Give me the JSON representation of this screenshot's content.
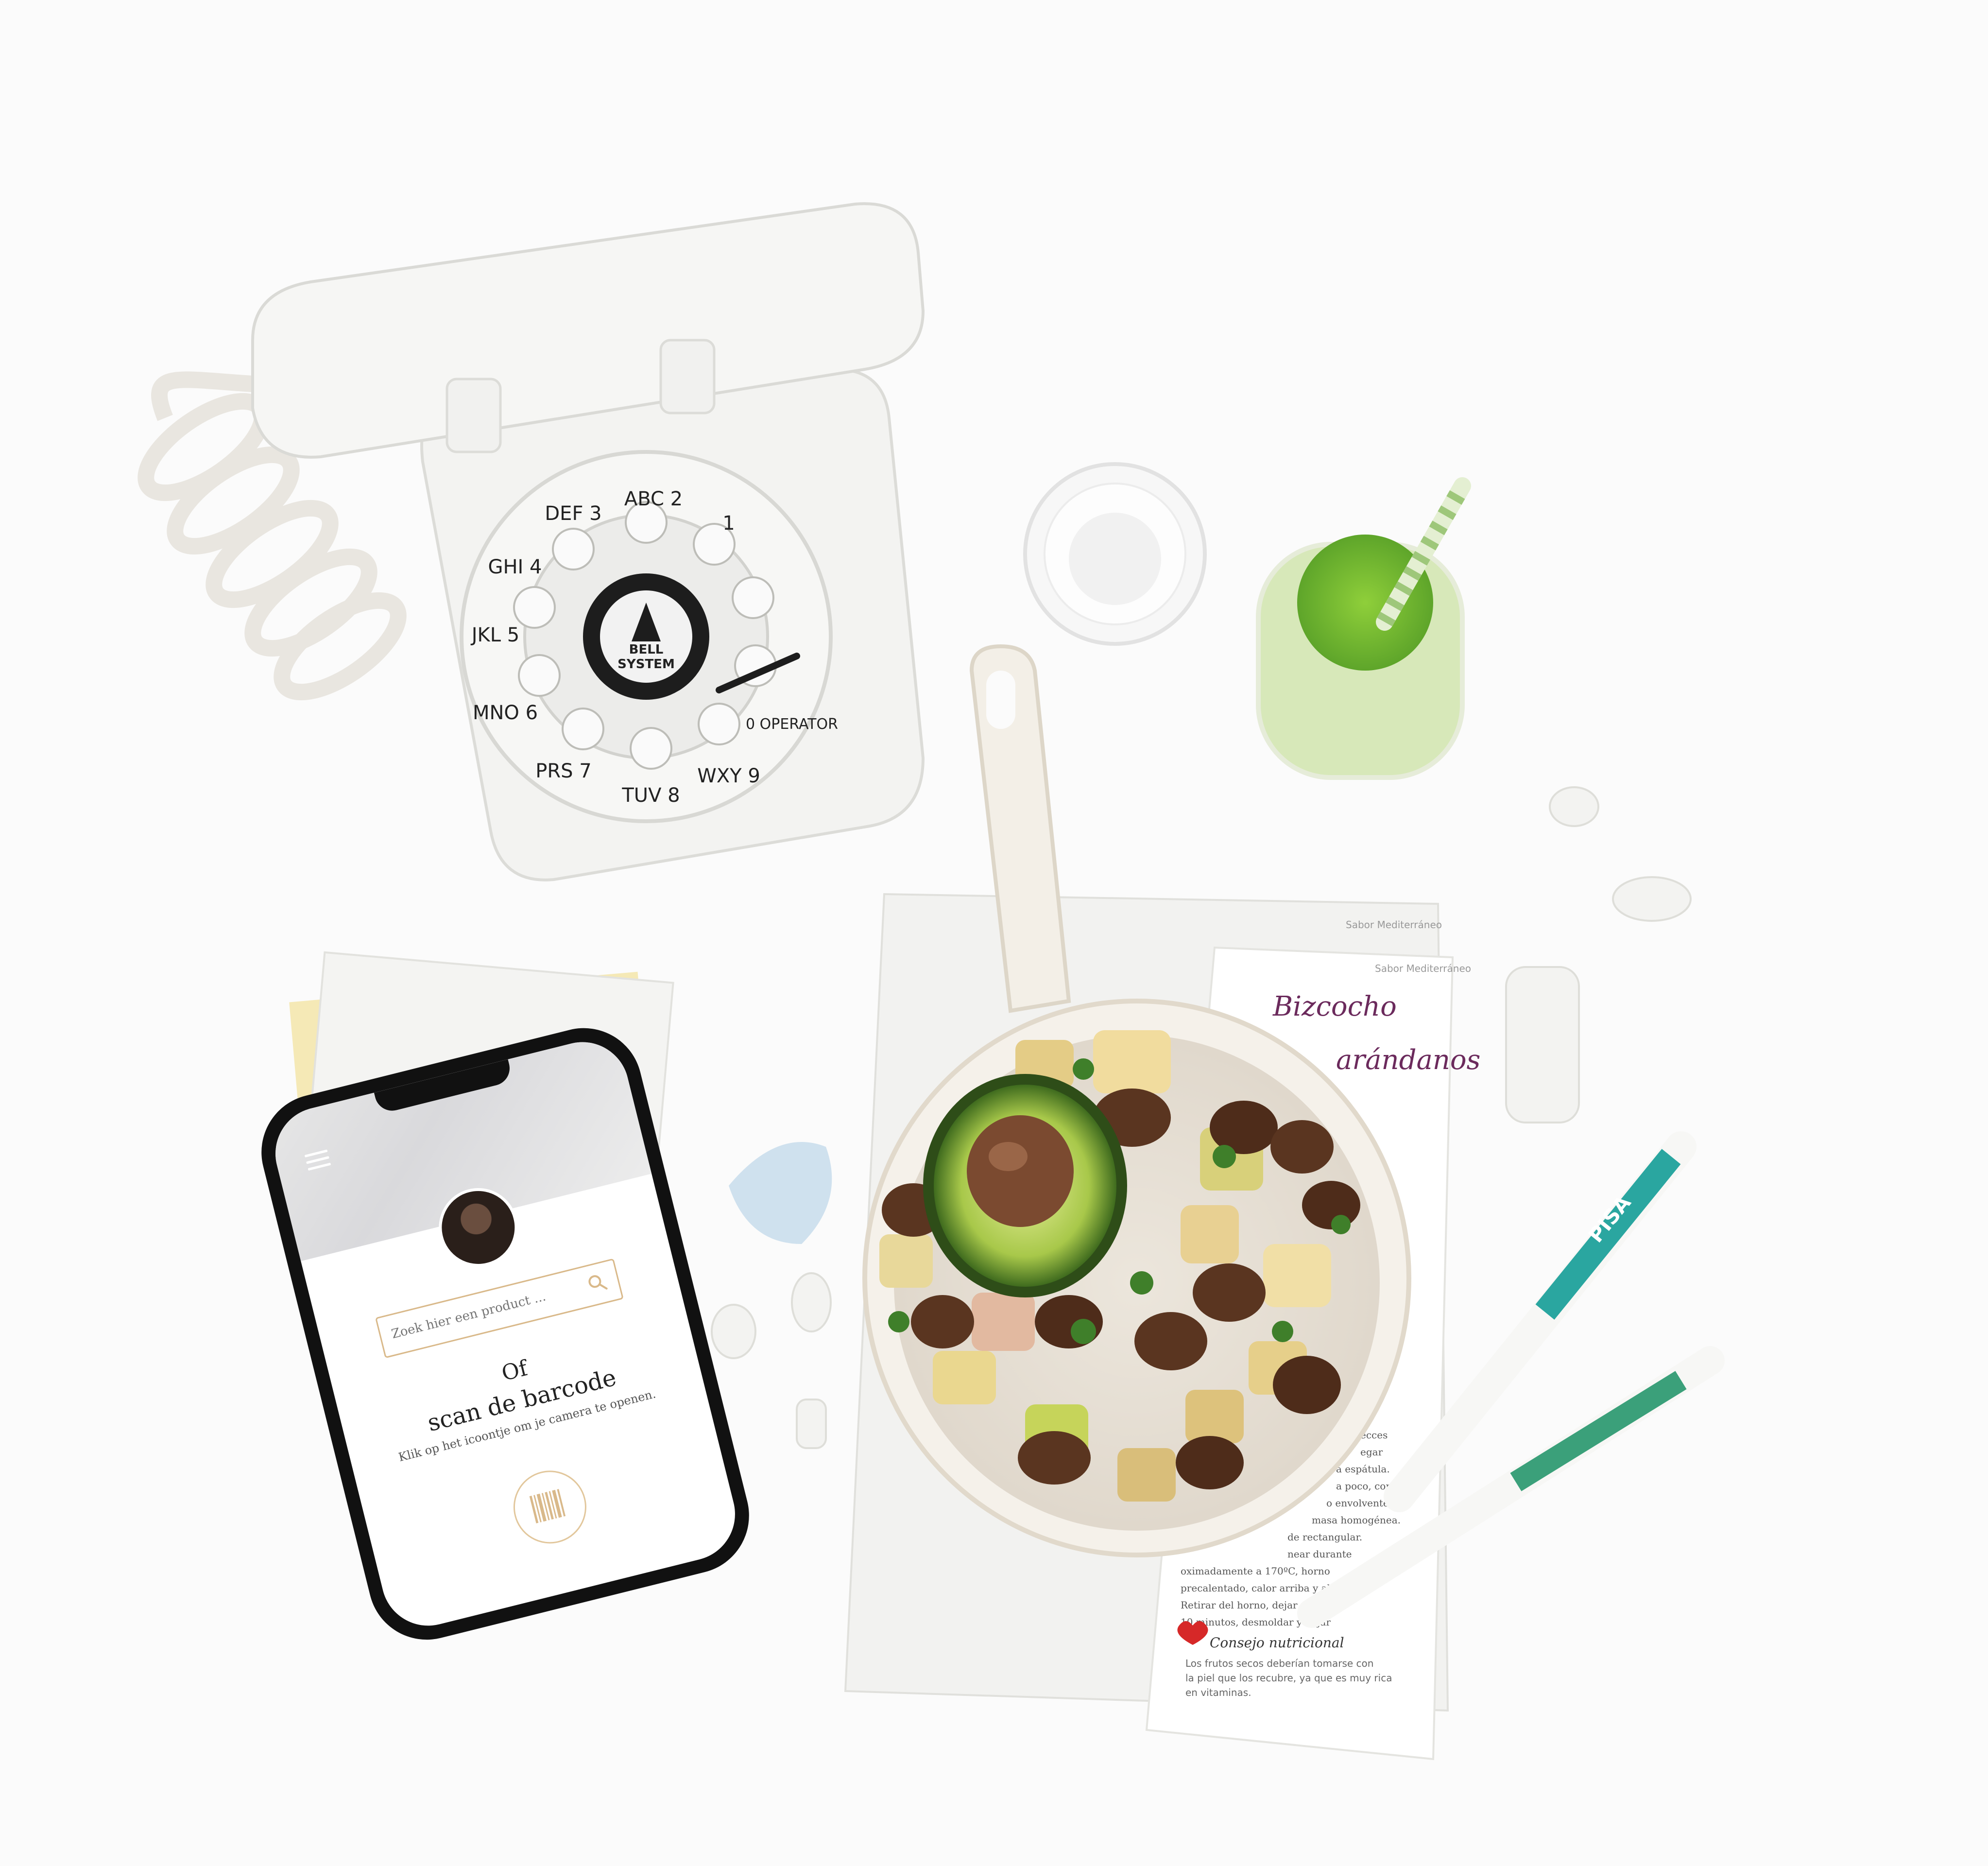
{
  "phone_app": {
    "search_placeholder": "Zoek hier een product ...",
    "heading_or": "Of",
    "heading_scan": "scan de barcode",
    "hint": "Klik op het icoontje om je camera te openen."
  },
  "magazine": {
    "header_top": "Sabor Mediterráneo",
    "header_mid": "Sabor Mediterráneo",
    "title_line1": "Bizcocho",
    "title_line2": "arándanos",
    "body_lines": [
      "ecces",
      "egar",
      "a espátula.",
      "a poco, con",
      "o envolvente.",
      "masa homogénea.",
      "de rectangular.",
      "near durante",
      "oximadamente a 170ºC, horno",
      "precalentado, calor arriba y abajo.",
      "Retirar del horno, dejar reposar",
      "10 minutos, desmoldar y dejar"
    ],
    "tip_title": "Consejo nutricional",
    "tip_text": [
      "Los frutos secos deberían tomarse con",
      "la piel que los recubre, ya que es muy rica",
      "en vitaminas."
    ]
  },
  "telephone_dial": {
    "labels": [
      "1",
      "ABC 2",
      "DEF 3",
      "GHI 4",
      "JKL 5",
      "MNO 6",
      "PRS 7",
      "TUV 8",
      "WXY 9",
      "0 OPERATOR"
    ],
    "center": [
      "BELL",
      "SYSTEM"
    ]
  },
  "pen_text": "PISA",
  "colors": {
    "background": "#fbfbfb",
    "phone_frame": "#111111",
    "smoothie": "#7fbf3a",
    "avocado": "#8fbf3f",
    "magazine_title": "#6b2a5c",
    "pen_accent": "#2aa6a0",
    "ui_accent": "#d9b98a"
  }
}
